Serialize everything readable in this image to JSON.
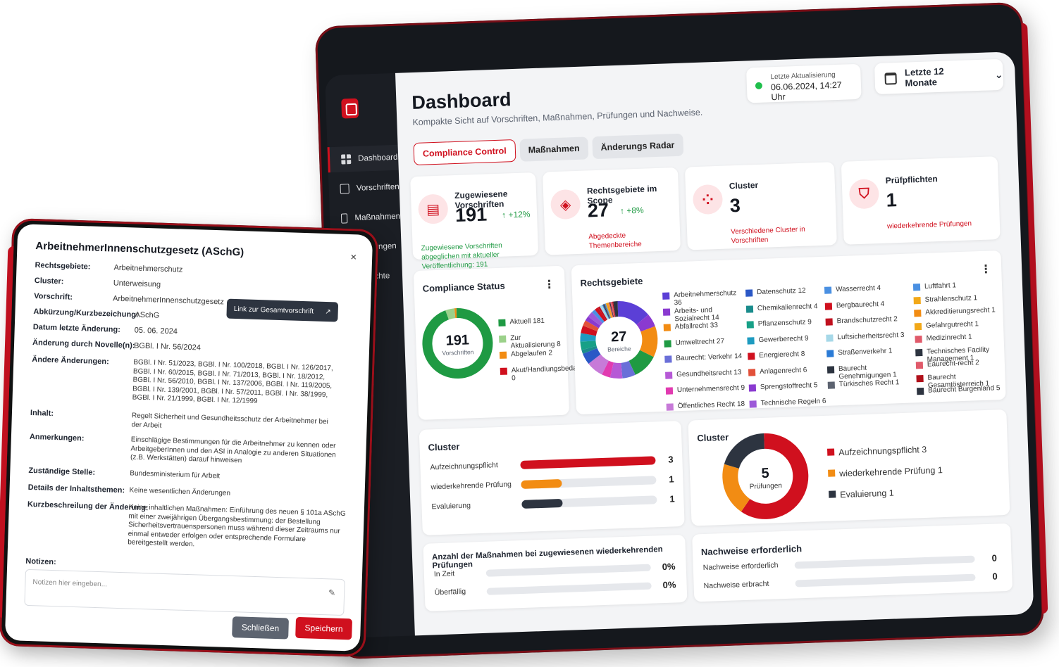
{
  "sidebar": {
    "items": [
      {
        "label": "Dashboard"
      },
      {
        "label": "Vorschriften"
      },
      {
        "label": "Maßnahmen"
      },
      {
        "label": "Prüfungen"
      },
      {
        "label": "Berichte"
      }
    ]
  },
  "header": {
    "title": "Dashboard",
    "subtitle": "Kompakte Sicht auf Vorschriften, Maßnahmen, Prüfungen und Nachweise.",
    "last_update_label": "Letzte Aktualisierung",
    "last_update_value": "06.06.2024, 14:27 Uhr",
    "period_select": "Letzte 12 Monate"
  },
  "tabs": [
    {
      "label": "Compliance Control"
    },
    {
      "label": "Maßnahmen"
    },
    {
      "label": "Änderungs Radar"
    }
  ],
  "kpis": [
    {
      "title": "Zugewiesene Vorschriften",
      "value": "191",
      "delta": "↑ +12%",
      "note": "Zugewiesene Vorschriften abgeglichen mit aktueller Veröffentlichung: 191"
    },
    {
      "title": "Rechtsgebiete im Scope",
      "value": "27",
      "delta": "↑ +8%",
      "note": "Abgedeckte Themenbereiche"
    },
    {
      "title": "Cluster",
      "value": "3",
      "note": "Verschiedene Cluster in Vorschriften"
    },
    {
      "title": "Prüfpflichten",
      "value": "1",
      "note": "wiederkehrende Prüfungen"
    }
  ],
  "compliance_status": {
    "title": "Compliance Status",
    "center_value": "191",
    "center_label": "Vorschriften",
    "legend": [
      {
        "label": "Aktuell 181",
        "value": 181,
        "color": "#1f9a43"
      },
      {
        "label": "Zur Aktualisierung 8",
        "value": 8,
        "color": "#9bd18a"
      },
      {
        "label": "Abgelaufen 2",
        "value": 2,
        "color": "#f28c13"
      },
      {
        "label": "Akut/Handlungsbedarf 0",
        "value": 0,
        "color": "#d0101e"
      }
    ]
  },
  "rechtsgebiete": {
    "title": "Rechtsgebiete",
    "center_value": "27",
    "center_label": "Bereiche",
    "columns": [
      [
        {
          "label": "Arbeitnehmerschutz 36",
          "color": "#5b3fd6"
        },
        {
          "label": "Arbeits- und Sozialrecht 14",
          "color": "#8a3ad0"
        },
        {
          "label": "Abfallrecht 33",
          "color": "#f28c13"
        },
        {
          "label": "Umweltrecht 27",
          "color": "#1f9a43"
        },
        {
          "label": "Baurecht: Verkehr 14",
          "color": "#6a6fd8"
        },
        {
          "label": "Gesundheitsrecht 13",
          "color": "#b659d6"
        },
        {
          "label": "Unternehmensrecht 9",
          "color": "#e13ab0"
        },
        {
          "label": "Öffentliches Recht 18",
          "color": "#c77ad8"
        }
      ],
      [
        {
          "label": "Datenschutz 12",
          "color": "#2b58c6"
        },
        {
          "label": "Chemikalienrecht 4",
          "color": "#1a8c8c"
        },
        {
          "label": "Pflanzenschutz 9",
          "color": "#17a087"
        },
        {
          "label": "Gewerberecht 9",
          "color": "#1e9bc0"
        },
        {
          "label": "Energierecht 8",
          "color": "#d0101e"
        },
        {
          "label": "Anlagenrecht 6",
          "color": "#e2513a"
        },
        {
          "label": "Sprengstoffrecht 5",
          "color": "#8a3ad0"
        },
        {
          "label": "Technische Regeln 6",
          "color": "#9c59d8"
        }
      ],
      [
        {
          "label": "Wasserrecht 4",
          "color": "#4a90e2"
        },
        {
          "label": "Bergbaurecht 4",
          "color": "#d0101e"
        },
        {
          "label": "Brandschutzrecht 2",
          "color": "#c0101e"
        },
        {
          "label": "Luftsicherheitsrecht 3",
          "color": "#a6d8e8"
        },
        {
          "label": "Straßenverkehr 1",
          "color": "#2b7bd6"
        },
        {
          "label": "Baurecht Genehmigungen 1",
          "color": "#2d3440"
        },
        {
          "label": "Türkisches Recht 1",
          "color": "#5c6370"
        }
      ],
      [
        {
          "label": "Luftfahrt 1",
          "color": "#4a90e2"
        },
        {
          "label": "Strahlenschutz 1",
          "color": "#f2a818"
        },
        {
          "label": "Akkreditierungsrecht 1",
          "color": "#f28c13"
        },
        {
          "label": "Gefahrgutrecht 1",
          "color": "#f2a818"
        },
        {
          "label": "Medizinrecht 1",
          "color": "#e05a6a"
        },
        {
          "label": "Technisches Facility Management 1",
          "color": "#2d3440"
        },
        {
          "label": "Eaurecht-recht 2",
          "color": "#e05a6a"
        },
        {
          "label": "Baurecht Gesamtösterreich 1",
          "color": "#b0101a"
        },
        {
          "label": "Baurecht Burgenland 5",
          "color": "#2d3440"
        }
      ]
    ]
  },
  "cluster_bars": {
    "title": "Cluster",
    "rows": [
      {
        "label": "Aufzeichnungspflicht",
        "value": 3,
        "max": 3,
        "color": "#d0101e"
      },
      {
        "label": "wiederkehrende Prüfung",
        "value": 1,
        "max": 3,
        "color": "#f28c13"
      },
      {
        "label": "Evaluierung",
        "value": 1,
        "max": 3,
        "color": "#2d3440"
      }
    ],
    "values_text": [
      "3",
      "1",
      "1"
    ]
  },
  "cluster_donut": {
    "title": "Cluster",
    "center_value": "5",
    "center_label": "Prüfungen",
    "legend": [
      {
        "label": "Aufzeichnungspflicht 3",
        "value": 3,
        "color": "#d0101e"
      },
      {
        "label": "wiederkehrende Prüfung 1",
        "value": 1,
        "color": "#f28c13"
      },
      {
        "label": "Evaluierung 1",
        "value": 1,
        "color": "#2d3440"
      }
    ]
  },
  "massnahmen": {
    "title": "Anzahl der Maßnahmen bei zugewiesenen wiederkehrenden Prüfungen",
    "rows": [
      {
        "label": "In Zeit",
        "value": "0%",
        "fraction": 0
      },
      {
        "label": "Überfällig",
        "value": "0%",
        "fraction": 0
      }
    ]
  },
  "nachweise": {
    "title": "Nachweise erforderlich",
    "rows": [
      {
        "label": "Nachweise erforderlich",
        "value": "0",
        "fraction": 0
      },
      {
        "label": "Nachweise erbracht",
        "value": "0",
        "fraction": 0
      }
    ]
  },
  "modal": {
    "title": "ArbeitnehmerInnenschutzgesetz (ASchG)",
    "close": "×",
    "fields": [
      {
        "key": "Rechtsgebiete:",
        "value": "Arbeitnehmerschutz"
      },
      {
        "key": "Cluster:",
        "value": "Unterweisung"
      },
      {
        "key": "Vorschrift:",
        "value": "ArbeitnehmerInnenschutzgesetz"
      },
      {
        "key": "Abkürzung/Kurzbezeichung:",
        "value": "ASchG"
      },
      {
        "key": "Datum letzte Änderung:",
        "value": "05. 06. 2024"
      },
      {
        "key": "Änderung durch Novelle(n):",
        "value": "BGBl. I Nr. 56/2024"
      },
      {
        "key": "Ändere Änderungen:",
        "value": "BGBl. I Nr. 51/2023, BGBl. I Nr. 100/2018, BGBl. I Nr. 126/2017, BGBl. I Nr. 60/2015, BGBl. I Nr. 71/2013, BGBl. I Nr. 18/2012, BGBl. I Nr. 56/2010, BGBl. I Nr. 137/2006, BGBl. I Nr. 119/2005, BGBl. I Nr. 139/2001, BGBl. I Nr. 57/2011, BGBl. I Nr. 38/1999, BGBl. I Nr. 21/1999, BGBl. I Nr. 12/1999"
      },
      {
        "key": "Inhalt:",
        "value": "Regelt Sicherheit und Gesundheitsschutz der Arbeitnehmer bei der Arbeit"
      },
      {
        "key": "Anmerkungen:",
        "value": "Einschlägige Bestimmungen für die Arbeitnehmer zu kennen oder ArbeitgeberInnen und den ASI in Analogie zu anderen Situationen (z.B. Werkstätten) darauf hinweisen"
      },
      {
        "key": "Zuständige Stelle:",
        "value": "Bundesministerium für Arbeit"
      },
      {
        "key": "Details der Inhaltsthemen:",
        "value": "Keine wesentlichen Änderungen"
      },
      {
        "key": "Kurzbeschreilung der Änderung:",
        "value": "Keine inhaltlichen Maßnahmen: Einführung des neuen § 101a ASchG mit einer zweijährigen Übergangsbestimmung: der Bestellung Sicherheitsvertrauenspersonen muss während dieser Zeitraums nur einmal entweder erfolgen oder entsprechende Formulare bereitgestellt werden."
      }
    ],
    "link_label": "Link zur Gesamtvorschrift",
    "notes_label": "Notizen:",
    "notes_placeholder": "Notizen hier eingeben...",
    "close_button": "Schließen",
    "save_button": "Speichern"
  }
}
